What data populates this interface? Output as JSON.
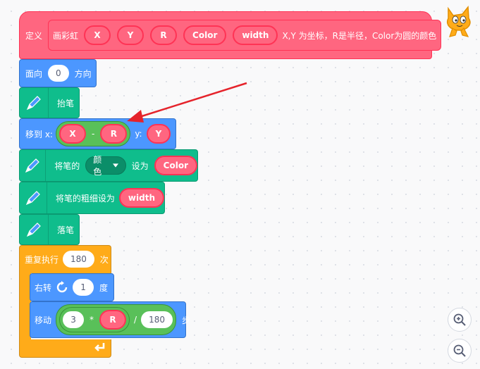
{
  "define_block": {
    "keyword": "定义",
    "name": "画彩虹",
    "params": [
      "X",
      "Y",
      "R",
      "Color",
      "width"
    ],
    "description": "X,Y 为坐标，R是半径，Color为圆的颜色"
  },
  "point_in_direction": {
    "prefix": "面向",
    "value": "0",
    "suffix": "方向"
  },
  "pen_up": {
    "label": "抬笔"
  },
  "go_to": {
    "prefix": "移到 x:",
    "x_left": "X",
    "x_operator": "-",
    "x_right": "R",
    "y_label": "y:",
    "y_value": "Y"
  },
  "set_pen_color": {
    "prefix": "将笔的",
    "dropdown": "颜色",
    "middle": "设为",
    "value": "Color"
  },
  "set_pen_size": {
    "prefix": "将笔的粗细设为",
    "value": "width"
  },
  "pen_down": {
    "label": "落笔"
  },
  "repeat": {
    "prefix": "重复执行",
    "count": "180",
    "suffix": "次"
  },
  "turn_right": {
    "prefix": "右转",
    "degrees": "1",
    "suffix": "度"
  },
  "move": {
    "prefix": "移动",
    "factor": "3",
    "multiply": "*",
    "radius": "R",
    "divide": "/",
    "divisor": "180",
    "suffix": "步"
  },
  "colors": {
    "define": "#ff6680",
    "motion": "#4c97ff",
    "pen": "#0fbd8c",
    "control": "#ffab19",
    "operator": "#59c059",
    "arrow": "#e5232b"
  },
  "icons": [
    "pen-icon",
    "rotate-right-icon",
    "loop-arrow-icon",
    "cat-sprite-icon",
    "zoom-in-icon",
    "zoom-out-icon"
  ]
}
